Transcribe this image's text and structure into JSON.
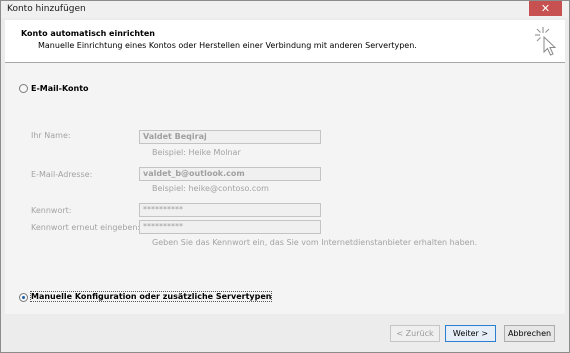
{
  "window": {
    "title": "Konto hinzufügen",
    "close_glyph": "✕"
  },
  "header": {
    "title": "Konto automatisch einrichten",
    "subtitle": "Manuelle Einrichtung eines Kontos oder Herstellen einer Verbindung mit anderen Servertypen.",
    "icon": "cursor-sparkle-icon"
  },
  "options": {
    "email_account": {
      "label": "E-Mail-Konto",
      "checked": false
    },
    "manual_config": {
      "label": "Manuelle Konfiguration oder zusätzliche Servertypen",
      "checked": true
    }
  },
  "form": {
    "name_label": "Ihr Name:",
    "name_value": "Valdet Beqiraj",
    "name_hint": "Beispiel: Heike Molnar",
    "email_label": "E-Mail-Adresse:",
    "email_value": "valdet_b@outlook.com",
    "email_hint": "Beispiel: heike@contoso.com",
    "password_label": "Kennwort:",
    "password_value": "**********",
    "password_repeat_label": "Kennwort erneut eingeben:",
    "password_repeat_value": "**********",
    "password_hint": "Geben Sie das Kennwort ein, das Sie vom Internetdienstanbieter erhalten haben."
  },
  "buttons": {
    "back": "< Zurück",
    "next": "Weiter >",
    "cancel": "Abbrechen"
  }
}
